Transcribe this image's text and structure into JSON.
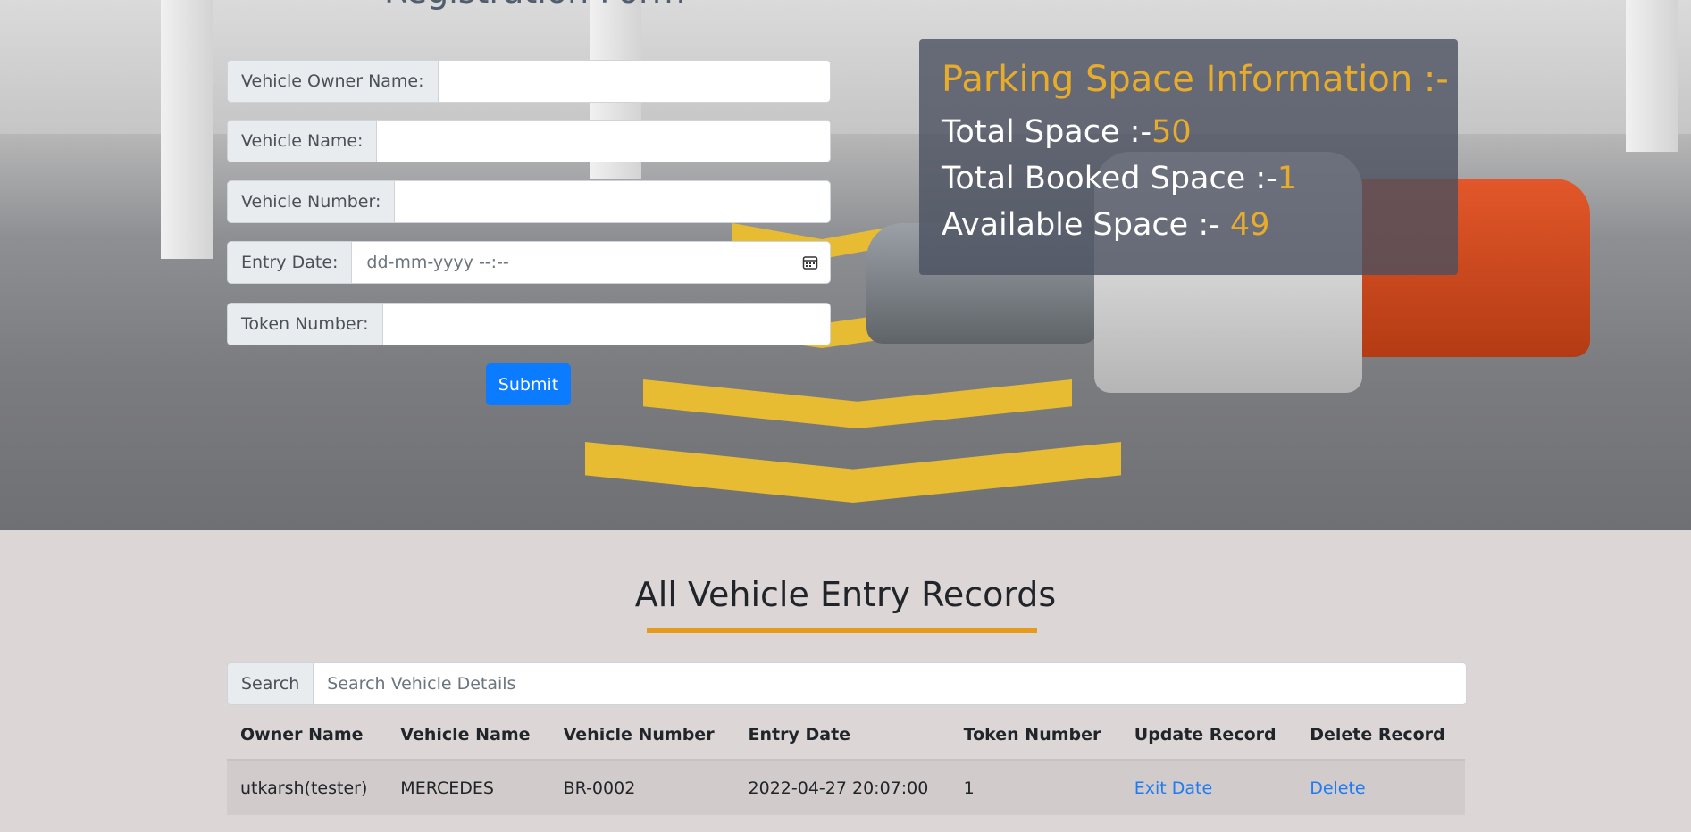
{
  "form": {
    "title": "Registration Form",
    "fields": [
      {
        "label": "Vehicle Owner Name:",
        "value": "",
        "placeholder": ""
      },
      {
        "label": "Vehicle Name:",
        "value": "",
        "placeholder": ""
      },
      {
        "label": "Vehicle Number:",
        "value": "",
        "placeholder": ""
      },
      {
        "label": "Entry Date:",
        "value": "",
        "placeholder": "dd-mm-yyyy --:--"
      },
      {
        "label": "Token Number:",
        "value": "",
        "placeholder": ""
      }
    ],
    "submit_label": "Submit",
    "calendar_icon": "calendar-icon"
  },
  "info": {
    "title": "Parking Space Information :-",
    "total_label": "Total Space :-",
    "total_value": "50",
    "booked_label": "Total Booked Space :-",
    "booked_value": "1",
    "available_label": "Available Space :- ",
    "available_value": "49"
  },
  "records": {
    "title": "All Vehicle Entry Records",
    "search_label": "Search",
    "search_placeholder": "Search Vehicle Details",
    "columns": [
      "Owner Name",
      "Vehicle Name",
      "Vehicle Number",
      "Entry Date",
      "Token Number",
      "Update Record",
      "Delete Record"
    ],
    "rows": [
      {
        "owner": "utkarsh(tester)",
        "vehicle": "MERCEDES",
        "number": "BR-0002",
        "entry": "2022-04-27 20:07:00",
        "token": "1",
        "update": "Exit Date",
        "delete": "Delete"
      }
    ]
  },
  "colors": {
    "accent": "#e8ac2d",
    "link": "#1e7bf2",
    "button": "#0b7bff"
  }
}
